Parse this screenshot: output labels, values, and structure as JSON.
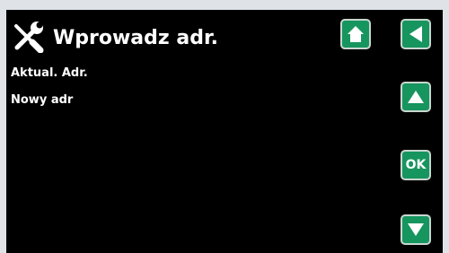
{
  "header": {
    "title": "Wprowadz adr.",
    "icon": "tools-icon"
  },
  "fields": {
    "current_address_label": "Aktual. Adr.",
    "new_address_label": "Nowy adr"
  },
  "buttons": {
    "home_icon": "home-icon",
    "back_icon": "back-arrow-icon",
    "up_icon": "up-arrow-icon",
    "ok_label": "OK",
    "down_icon": "down-arrow-icon"
  },
  "colors": {
    "screen_background": "#000000",
    "button_green": "#17955f",
    "text": "#ffffff"
  }
}
